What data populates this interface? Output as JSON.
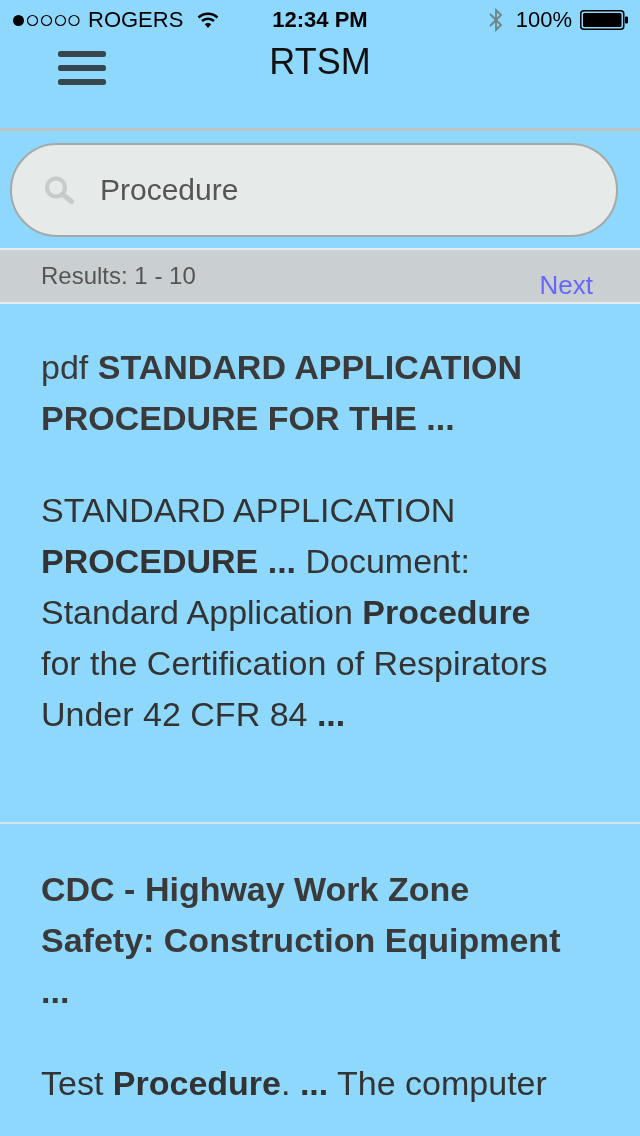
{
  "status_bar": {
    "carrier": "ROGERS",
    "time": "12:34 PM",
    "battery": "100%"
  },
  "nav_bar": {
    "title": "RTSM"
  },
  "search": {
    "value": "Procedure"
  },
  "results_bar": {
    "summary": "Results: 1 - 10",
    "next": "Next"
  },
  "results": [
    {
      "file_type": "pdf",
      "title": "STANDARD APPLICATION PROCEDURE FOR THE ...",
      "snippet": "STANDARD APPLICATION **PROCEDURE ...** Document: Standard Application **Procedure** for the Certification of Respirators Under 42 CFR 84 **...**"
    },
    {
      "title": "CDC - Highway Work Zone Safety: Construction Equipment ...",
      "snippet": "Test **Procedure**. **...** The computer"
    }
  ]
}
